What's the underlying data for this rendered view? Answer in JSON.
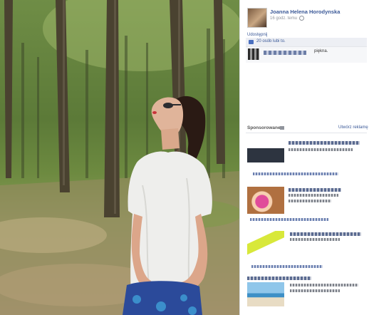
{
  "post": {
    "author": "Joanna Helena Horodynska",
    "time": "16 godz. temu",
    "share": "Udostępnij",
    "likes": "20 osób lubi to.",
    "comment_text": "piękna."
  },
  "ads": {
    "header": "Sponsorowane",
    "create_link": "Utwórz reklamę"
  },
  "icons": {
    "globe": "globe-icon",
    "like": "like-thumb-icon",
    "sponsored_info": "info-icon"
  },
  "colors": {
    "link": "#3b5998",
    "likes_bg": "#edeff4",
    "panel_border": "#dcdee3"
  }
}
